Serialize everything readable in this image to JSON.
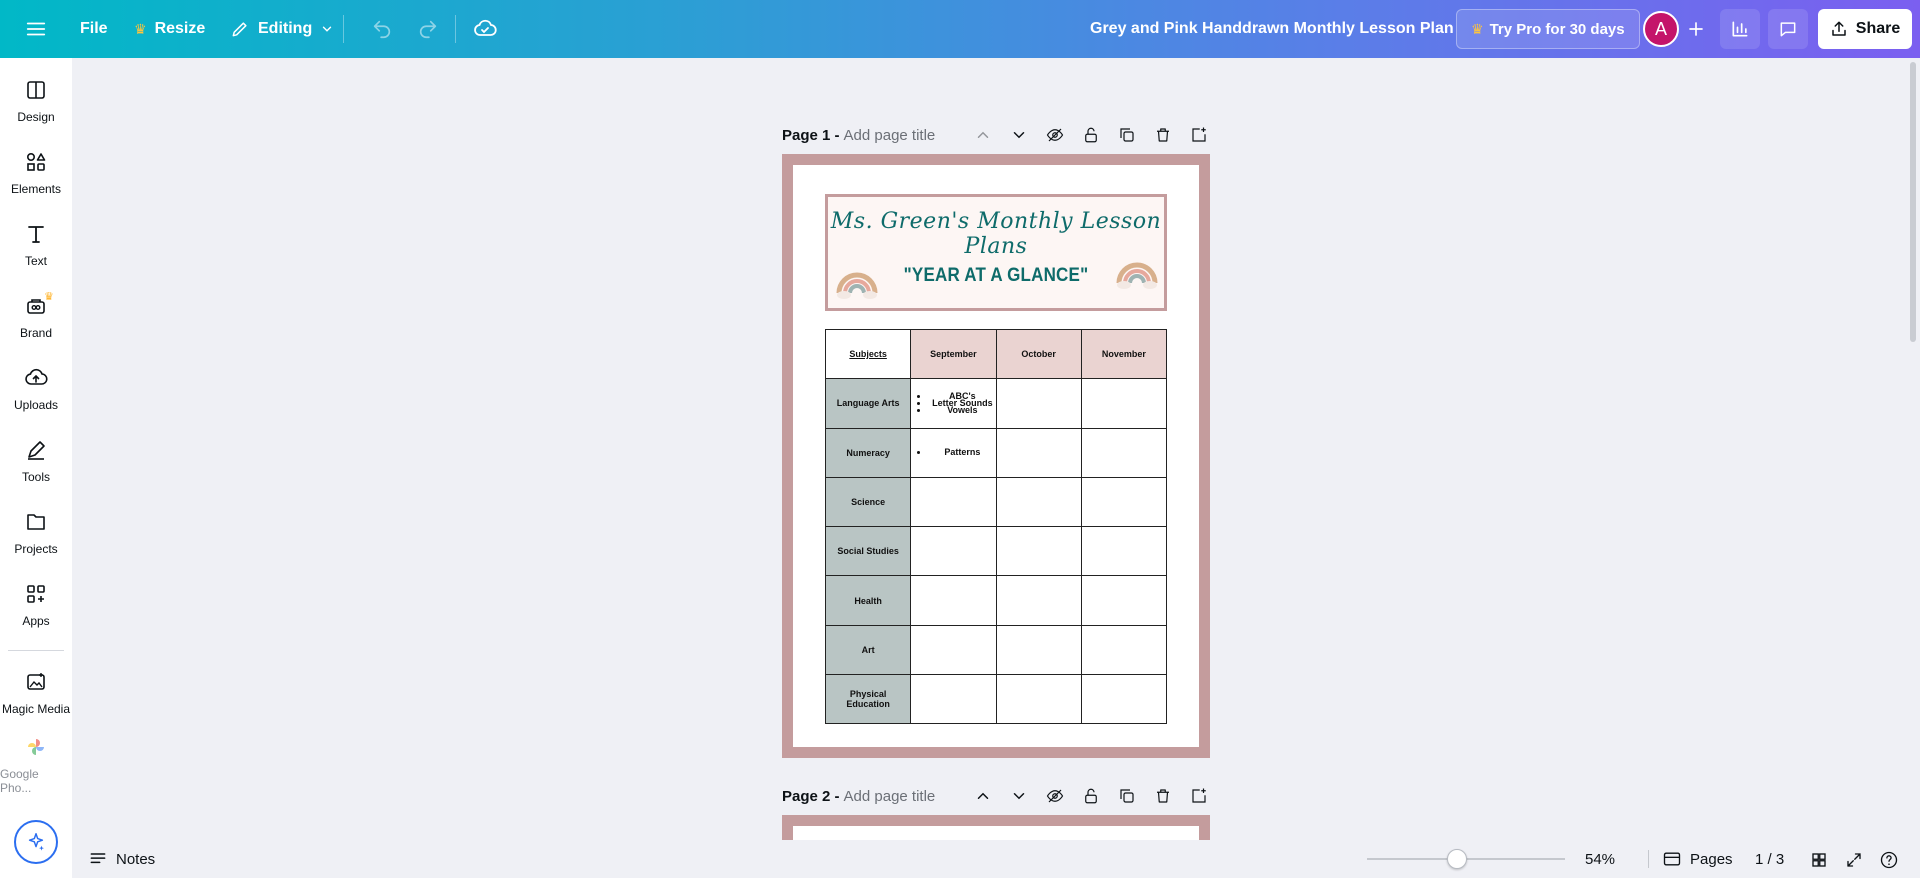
{
  "topbar": {
    "menu_icon": "hamburger-icon",
    "file_label": "File",
    "resize_label": "Resize",
    "editing_label": "Editing",
    "doc_title": "Grey and Pink Handdrawn Monthly Lesson Plan",
    "pro_label": "Try Pro for 30 days",
    "avatar_initial": "A",
    "share_label": "Share"
  },
  "rail": {
    "items": [
      {
        "label": "Design",
        "icon": "design-icon"
      },
      {
        "label": "Elements",
        "icon": "elements-icon"
      },
      {
        "label": "Text",
        "icon": "text-icon"
      },
      {
        "label": "Brand",
        "icon": "brand-icon"
      },
      {
        "label": "Uploads",
        "icon": "uploads-icon"
      },
      {
        "label": "Tools",
        "icon": "tools-icon"
      },
      {
        "label": "Projects",
        "icon": "projects-icon"
      },
      {
        "label": "Apps",
        "icon": "apps-icon"
      },
      {
        "label": "Magic Media",
        "icon": "magic-media-icon"
      },
      {
        "label": "Google Pho...",
        "icon": "google-photos-icon"
      }
    ]
  },
  "pages": [
    {
      "label": "Page 1 -",
      "title_placeholder": "Add page title"
    },
    {
      "label": "Page 2 -",
      "title_placeholder": "Add page title"
    }
  ],
  "design": {
    "banner_title": "Ms. Green's Monthly Lesson Plans",
    "banner_subtitle": "\"YEAR AT A GLANCE\"",
    "table": {
      "header": [
        "Subjects",
        "September",
        "October",
        "November"
      ],
      "rows": [
        "Language Arts",
        "Numeracy",
        "Science",
        "Social Studies",
        "Health",
        "Art",
        "Physical Education"
      ],
      "language_arts_sept": [
        "ABC's",
        "Letter Sounds",
        "Vowels"
      ],
      "numeracy_sept": [
        "Patterns"
      ]
    }
  },
  "bottombar": {
    "notes_label": "Notes",
    "zoom": "54%",
    "zoom_fraction": 0.54,
    "pages_label": "Pages",
    "page_count": "1 / 3"
  },
  "colors": {
    "accent_gradient_start": "#01b8c7",
    "accent_gradient_end": "#7b5ff0",
    "page_border": "#c49c9d",
    "table_header": "#ead3d1",
    "row_header": "#b9c5c4",
    "title_teal": "#0e6b6a"
  }
}
